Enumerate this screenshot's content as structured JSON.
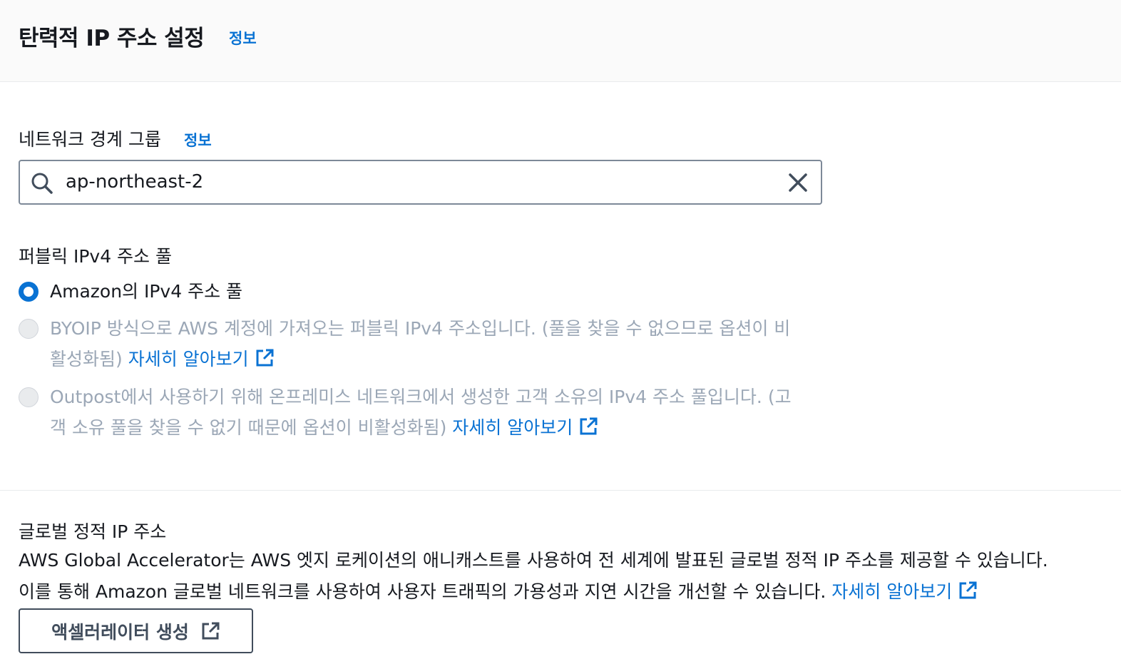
{
  "header": {
    "title": "탄력적 IP 주소 설정",
    "info": "정보"
  },
  "network_border_group": {
    "label": "네트워크 경계 그룹",
    "info": "정보",
    "value": "ap-northeast-2"
  },
  "ipv4_pool": {
    "label": "퍼블릭 IPv4 주소 풀",
    "options": [
      {
        "text": "Amazon의 IPv4 주소 풀",
        "selected": true,
        "disabled": false
      },
      {
        "text_line1": "BYOIP 방식으로 AWS 계정에 가져오는 퍼블릭 IPv4 주소입니다. (풀을 찾을 수 없으므로 옵션이 비",
        "text_line2": "활성화됨)",
        "link": "자세히 알아보기",
        "selected": false,
        "disabled": true
      },
      {
        "text_line1": "Outpost에서 사용하기 위해 온프레미스 네트워크에서 생성한 고객 소유의 IPv4 주소 풀입니다. (고",
        "text_line2": "객 소유 풀을 찾을 수 없기 때문에 옵션이 비활성화됨)",
        "link": "자세히 알아보기",
        "selected": false,
        "disabled": true
      }
    ]
  },
  "global_static_ip": {
    "label": "글로벌 정적 IP 주소",
    "line1": "AWS Global Accelerator는 AWS 엣지 로케이션의 애니캐스트를 사용하여 전 세계에 발표된 글로벌 정적 IP 주소를 제공할 수 있습니다.",
    "line2": "이를 통해 Amazon 글로벌 네트워크를 사용하여 사용자 트래픽의 가용성과 지연 시간을 개선할 수 있습니다.",
    "link": "자세히 알아보기",
    "button": "액셀러레이터 생성"
  },
  "colors": {
    "link": "#0972d3",
    "text": "#16191f",
    "disabled": "#9ba7b6"
  }
}
